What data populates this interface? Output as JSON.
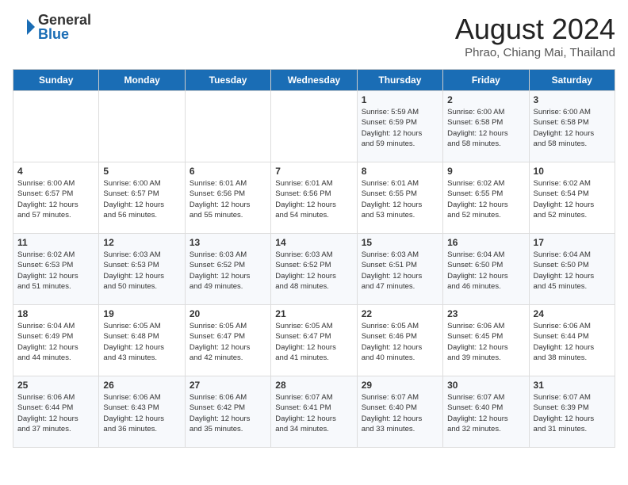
{
  "header": {
    "logo_general": "General",
    "logo_blue": "Blue",
    "month_title": "August 2024",
    "subtitle": "Phrao, Chiang Mai, Thailand"
  },
  "days_of_week": [
    "Sunday",
    "Monday",
    "Tuesday",
    "Wednesday",
    "Thursday",
    "Friday",
    "Saturday"
  ],
  "weeks": [
    [
      {
        "day": "",
        "info": ""
      },
      {
        "day": "",
        "info": ""
      },
      {
        "day": "",
        "info": ""
      },
      {
        "day": "",
        "info": ""
      },
      {
        "day": "1",
        "info": "Sunrise: 5:59 AM\nSunset: 6:59 PM\nDaylight: 12 hours\nand 59 minutes."
      },
      {
        "day": "2",
        "info": "Sunrise: 6:00 AM\nSunset: 6:58 PM\nDaylight: 12 hours\nand 58 minutes."
      },
      {
        "day": "3",
        "info": "Sunrise: 6:00 AM\nSunset: 6:58 PM\nDaylight: 12 hours\nand 58 minutes."
      }
    ],
    [
      {
        "day": "4",
        "info": "Sunrise: 6:00 AM\nSunset: 6:57 PM\nDaylight: 12 hours\nand 57 minutes."
      },
      {
        "day": "5",
        "info": "Sunrise: 6:00 AM\nSunset: 6:57 PM\nDaylight: 12 hours\nand 56 minutes."
      },
      {
        "day": "6",
        "info": "Sunrise: 6:01 AM\nSunset: 6:56 PM\nDaylight: 12 hours\nand 55 minutes."
      },
      {
        "day": "7",
        "info": "Sunrise: 6:01 AM\nSunset: 6:56 PM\nDaylight: 12 hours\nand 54 minutes."
      },
      {
        "day": "8",
        "info": "Sunrise: 6:01 AM\nSunset: 6:55 PM\nDaylight: 12 hours\nand 53 minutes."
      },
      {
        "day": "9",
        "info": "Sunrise: 6:02 AM\nSunset: 6:55 PM\nDaylight: 12 hours\nand 52 minutes."
      },
      {
        "day": "10",
        "info": "Sunrise: 6:02 AM\nSunset: 6:54 PM\nDaylight: 12 hours\nand 52 minutes."
      }
    ],
    [
      {
        "day": "11",
        "info": "Sunrise: 6:02 AM\nSunset: 6:53 PM\nDaylight: 12 hours\nand 51 minutes."
      },
      {
        "day": "12",
        "info": "Sunrise: 6:03 AM\nSunset: 6:53 PM\nDaylight: 12 hours\nand 50 minutes."
      },
      {
        "day": "13",
        "info": "Sunrise: 6:03 AM\nSunset: 6:52 PM\nDaylight: 12 hours\nand 49 minutes."
      },
      {
        "day": "14",
        "info": "Sunrise: 6:03 AM\nSunset: 6:52 PM\nDaylight: 12 hours\nand 48 minutes."
      },
      {
        "day": "15",
        "info": "Sunrise: 6:03 AM\nSunset: 6:51 PM\nDaylight: 12 hours\nand 47 minutes."
      },
      {
        "day": "16",
        "info": "Sunrise: 6:04 AM\nSunset: 6:50 PM\nDaylight: 12 hours\nand 46 minutes."
      },
      {
        "day": "17",
        "info": "Sunrise: 6:04 AM\nSunset: 6:50 PM\nDaylight: 12 hours\nand 45 minutes."
      }
    ],
    [
      {
        "day": "18",
        "info": "Sunrise: 6:04 AM\nSunset: 6:49 PM\nDaylight: 12 hours\nand 44 minutes."
      },
      {
        "day": "19",
        "info": "Sunrise: 6:05 AM\nSunset: 6:48 PM\nDaylight: 12 hours\nand 43 minutes."
      },
      {
        "day": "20",
        "info": "Sunrise: 6:05 AM\nSunset: 6:47 PM\nDaylight: 12 hours\nand 42 minutes."
      },
      {
        "day": "21",
        "info": "Sunrise: 6:05 AM\nSunset: 6:47 PM\nDaylight: 12 hours\nand 41 minutes."
      },
      {
        "day": "22",
        "info": "Sunrise: 6:05 AM\nSunset: 6:46 PM\nDaylight: 12 hours\nand 40 minutes."
      },
      {
        "day": "23",
        "info": "Sunrise: 6:06 AM\nSunset: 6:45 PM\nDaylight: 12 hours\nand 39 minutes."
      },
      {
        "day": "24",
        "info": "Sunrise: 6:06 AM\nSunset: 6:44 PM\nDaylight: 12 hours\nand 38 minutes."
      }
    ],
    [
      {
        "day": "25",
        "info": "Sunrise: 6:06 AM\nSunset: 6:44 PM\nDaylight: 12 hours\nand 37 minutes."
      },
      {
        "day": "26",
        "info": "Sunrise: 6:06 AM\nSunset: 6:43 PM\nDaylight: 12 hours\nand 36 minutes."
      },
      {
        "day": "27",
        "info": "Sunrise: 6:06 AM\nSunset: 6:42 PM\nDaylight: 12 hours\nand 35 minutes."
      },
      {
        "day": "28",
        "info": "Sunrise: 6:07 AM\nSunset: 6:41 PM\nDaylight: 12 hours\nand 34 minutes."
      },
      {
        "day": "29",
        "info": "Sunrise: 6:07 AM\nSunset: 6:40 PM\nDaylight: 12 hours\nand 33 minutes."
      },
      {
        "day": "30",
        "info": "Sunrise: 6:07 AM\nSunset: 6:40 PM\nDaylight: 12 hours\nand 32 minutes."
      },
      {
        "day": "31",
        "info": "Sunrise: 6:07 AM\nSunset: 6:39 PM\nDaylight: 12 hours\nand 31 minutes."
      }
    ]
  ]
}
